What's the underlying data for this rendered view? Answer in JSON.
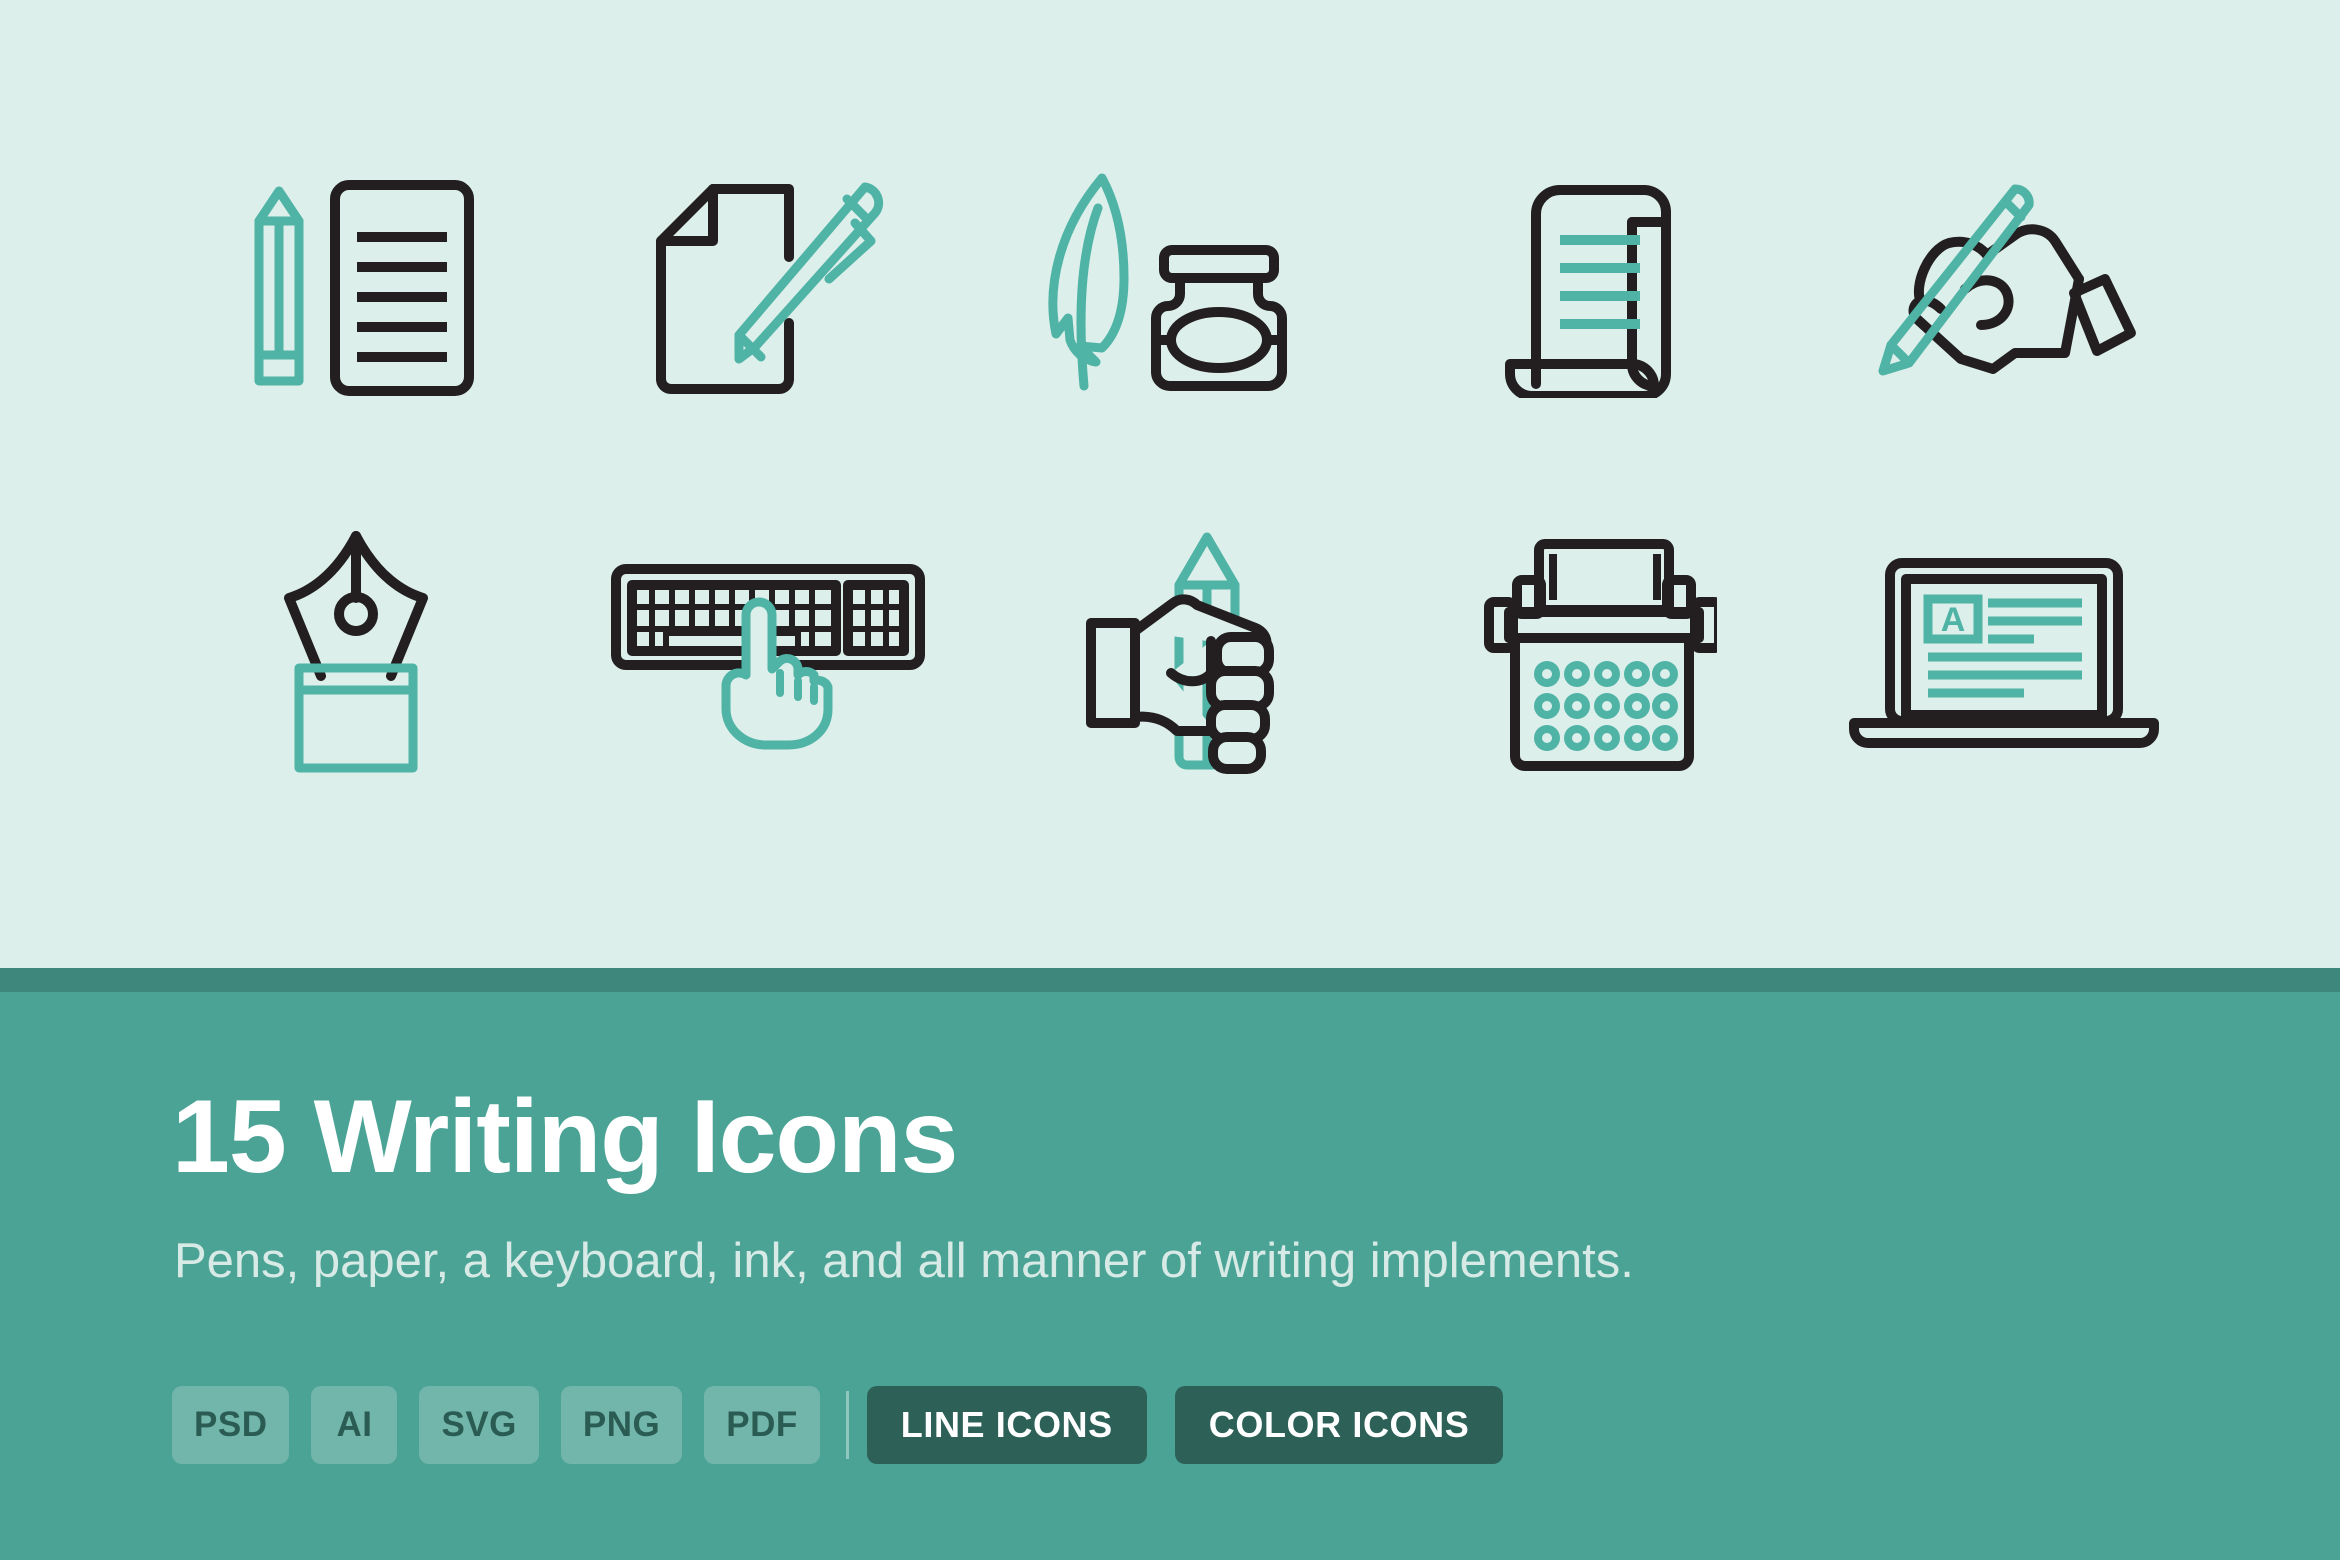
{
  "theme": {
    "stage_bg": "#dcefeb",
    "stripe": "#3e877d",
    "panel_bg": "#4ba396",
    "ink_dark": "#231f20",
    "ink_teal": "#4fb3a6",
    "chip_bg": "#72b5aa",
    "chip_text": "#2a5c53",
    "cta_bg": "#2d6158",
    "cta_text": "#ffffff",
    "headline_color": "#ffffff",
    "subhead_color": "#d7eae6"
  },
  "footer": {
    "headline": "15 Writing Icons",
    "subhead": "Pens, paper, a keyboard, ink, and all manner of writing implements.",
    "formats": [
      "PSD",
      "AI",
      "SVG",
      "PNG",
      "PDF"
    ],
    "buttons": [
      {
        "label": "LINE ICONS"
      },
      {
        "label": "COLOR ICONS"
      }
    ]
  },
  "icons": {
    "count": 15,
    "rows": [
      [
        {
          "name": "pencil-and-notepad-icon",
          "label": "Pencil and notepad"
        },
        {
          "name": "document-and-pen-icon",
          "label": "Document and pen"
        },
        {
          "name": "quill-and-inkwell-icon",
          "label": "Quill feather and inkwell"
        },
        {
          "name": "scroll-icon",
          "label": "Paper scroll"
        },
        {
          "name": "hand-writing-pencil-icon",
          "label": "Hand writing with pencil"
        }
      ],
      [
        {
          "name": "fountain-pen-nib-icon",
          "label": "Fountain pen nib"
        },
        {
          "name": "keyboard-typing-icon",
          "label": "Keyboard with pointing hand"
        },
        {
          "name": "hand-holding-pencil-icon",
          "label": "Hand holding pencil"
        },
        {
          "name": "typewriter-icon",
          "label": "Typewriter"
        },
        {
          "name": "laptop-document-icon",
          "label": "Laptop with document"
        }
      ]
    ],
    "laptop_screen_letter": "A"
  }
}
